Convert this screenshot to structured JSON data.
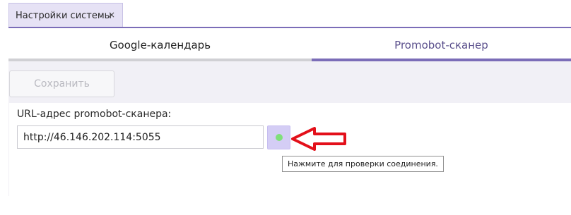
{
  "doc_tab": {
    "label": "Настройки системы",
    "close": "×"
  },
  "tabs": [
    {
      "label": "Google-календарь"
    },
    {
      "label": "Promobot-сканер"
    }
  ],
  "toolbar": {
    "save_label": "Сохранить"
  },
  "form": {
    "url_label": "URL-адрес promobot-сканера:",
    "url_value": "http://46.146.202.114:5055",
    "tooltip": "Нажмите для проверки соединения."
  },
  "colors": {
    "accent": "#7b6db8",
    "status_ok": "#7fe07a",
    "annotation_arrow": "#e3101a"
  },
  "icons": {
    "status": "status-dot-icon",
    "annotation": "red-arrow-annotation"
  }
}
